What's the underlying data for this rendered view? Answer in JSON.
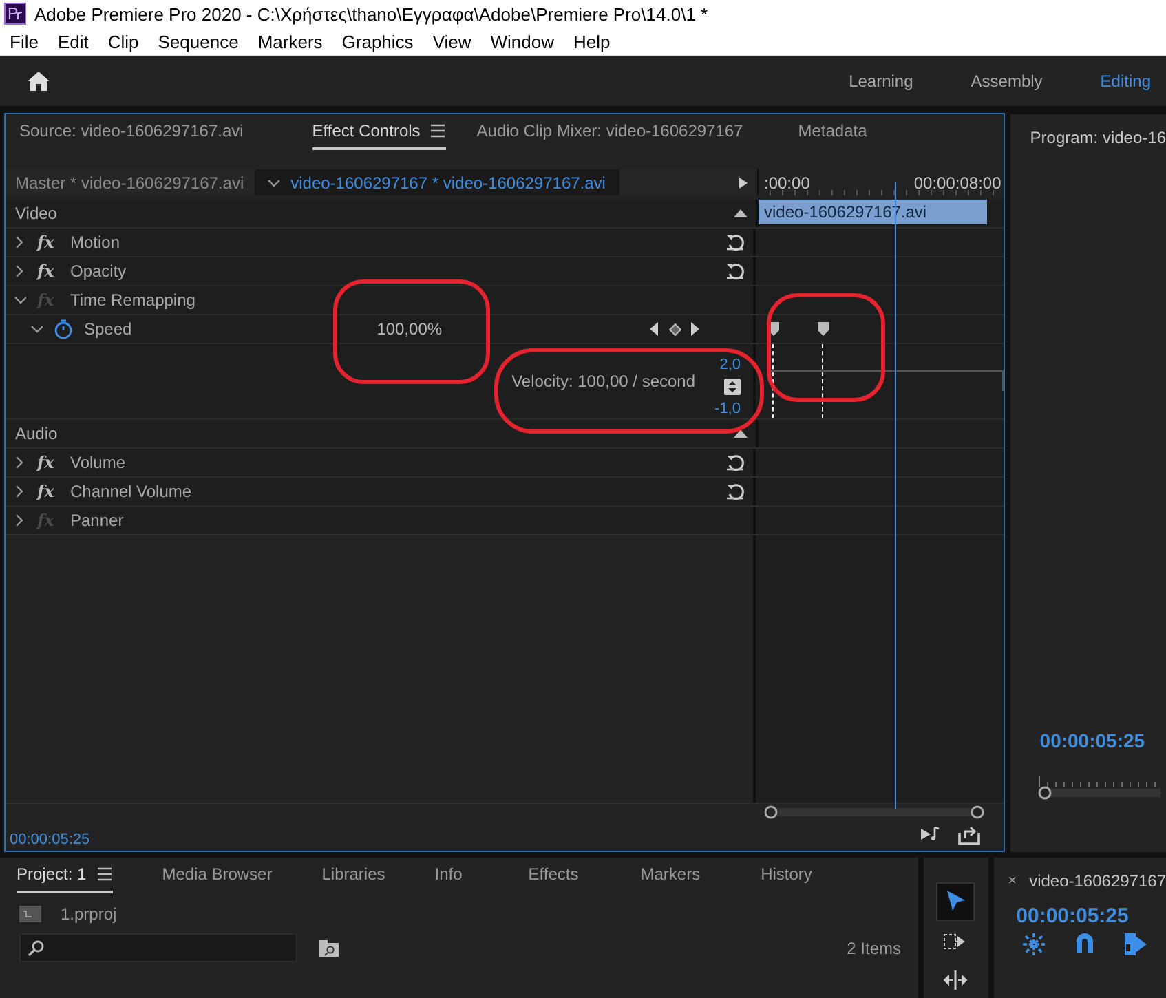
{
  "window": {
    "title": "Adobe Premiere Pro 2020 - C:\\Χρήστες\\thano\\Εγγραφα\\Adobe\\Premiere Pro\\14.0\\1 *"
  },
  "menu": [
    "File",
    "Edit",
    "Clip",
    "Sequence",
    "Markers",
    "Graphics",
    "View",
    "Window",
    "Help"
  ],
  "workspaces": [
    {
      "label": "Learning",
      "selected": false
    },
    {
      "label": "Assembly",
      "selected": false
    },
    {
      "label": "Editing",
      "selected": true
    }
  ],
  "effect_panel": {
    "tabs": [
      {
        "label": "Source: video-1606297167.avi",
        "selected": false,
        "menu": false
      },
      {
        "label": "Effect Controls",
        "selected": true,
        "menu": true
      },
      {
        "label": "Audio Clip Mixer: video-1606297167",
        "selected": false,
        "menu": false
      },
      {
        "label": "Metadata",
        "selected": false,
        "menu": false
      }
    ],
    "master": "Master * video-1606297167.avi",
    "clip": "video-1606297167 * video-1606297167.avi",
    "ruler": {
      "start": ":00:00",
      "end": "00:00:08:00"
    },
    "clip_bar": "video-1606297167.avi",
    "sections": [
      {
        "label": "Video",
        "effects": [
          {
            "icon": "fx",
            "name": "Motion",
            "active": true,
            "expanded": false,
            "reset": true
          },
          {
            "icon": "fx",
            "name": "Opacity",
            "active": true,
            "expanded": false,
            "reset": true
          },
          {
            "icon": "fx",
            "name": "Time Remapping",
            "active": false,
            "expanded": true,
            "reset": false,
            "children": [
              {
                "name": "Speed",
                "expanded": true,
                "value": "100,00%",
                "velocity": "Velocity: 100,00 / second",
                "max": "2,0",
                "min": "-1,0"
              }
            ]
          }
        ]
      },
      {
        "label": "Audio",
        "effects": [
          {
            "icon": "fx",
            "name": "Volume",
            "active": true,
            "expanded": false,
            "reset": true
          },
          {
            "icon": "fx",
            "name": "Channel Volume",
            "active": true,
            "expanded": false,
            "reset": true
          },
          {
            "icon": "fx",
            "name": "Panner",
            "active": false,
            "expanded": false,
            "reset": false
          }
        ]
      }
    ],
    "timecode": "00:00:05:25"
  },
  "program": {
    "title": "Program: video-16",
    "timecode": "00:00:05:25"
  },
  "project": {
    "tabs": [
      {
        "label": "Project: 1",
        "selected": true,
        "menu": true
      },
      {
        "label": "Media Browser",
        "selected": false,
        "menu": false
      },
      {
        "label": "Libraries",
        "selected": false,
        "menu": false
      },
      {
        "label": "Info",
        "selected": false,
        "menu": false
      },
      {
        "label": "Effects",
        "selected": false,
        "menu": false
      },
      {
        "label": "Markers",
        "selected": false,
        "menu": false
      },
      {
        "label": "History",
        "selected": false,
        "menu": false
      }
    ],
    "file": "1.prproj",
    "count": "2 Items"
  },
  "tools": [
    {
      "kind": "selection",
      "selected": true
    },
    {
      "kind": "track-select",
      "selected": false
    },
    {
      "kind": "ripple",
      "selected": false
    }
  ],
  "timeline": {
    "title": "video-1606297167",
    "close": "×",
    "timecode": "00:00:05:25"
  }
}
